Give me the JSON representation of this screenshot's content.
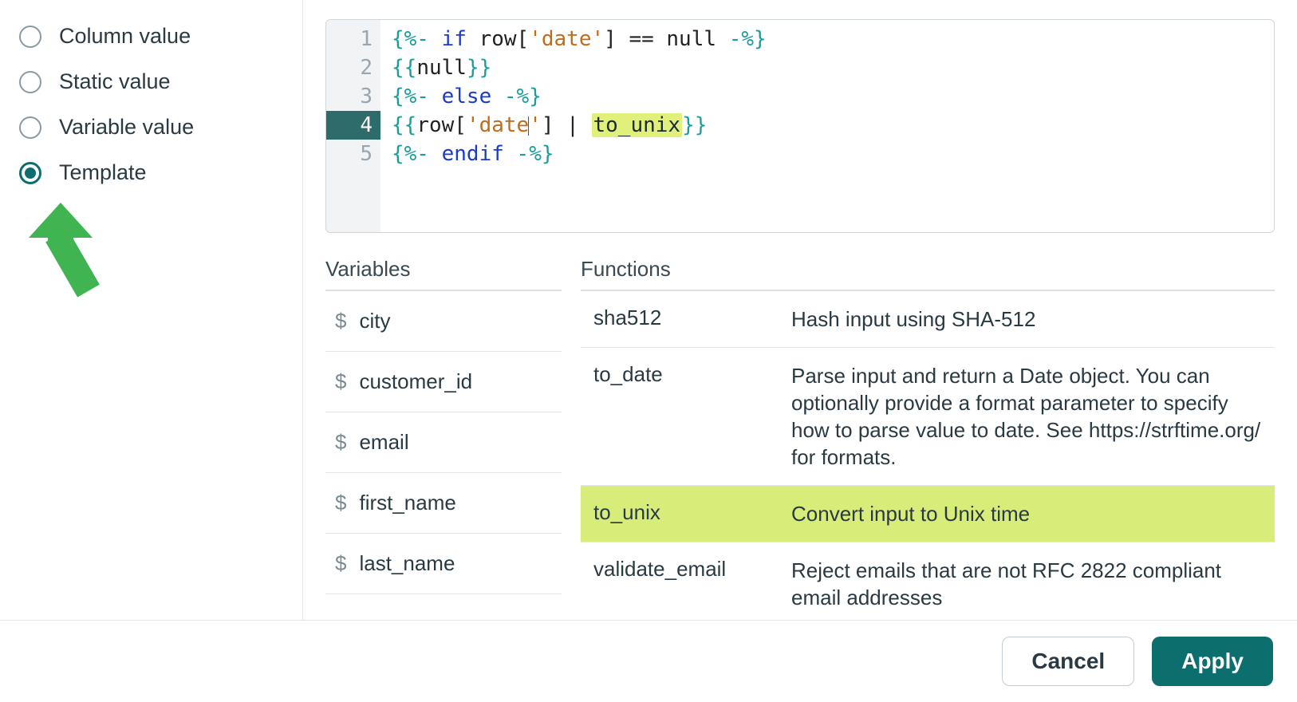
{
  "sidebar": {
    "options": [
      {
        "label": "Column value",
        "selected": false
      },
      {
        "label": "Static value",
        "selected": false
      },
      {
        "label": "Variable value",
        "selected": false
      },
      {
        "label": "Template",
        "selected": true
      }
    ]
  },
  "editor": {
    "active_line": 4,
    "lines": [
      {
        "n": 1,
        "tokens": [
          {
            "t": "{%- ",
            "c": "delim"
          },
          {
            "t": "if",
            "c": "kw"
          },
          {
            "t": " row[",
            "c": "text"
          },
          {
            "t": "'date'",
            "c": "str"
          },
          {
            "t": "] == null ",
            "c": "text"
          },
          {
            "t": "-%}",
            "c": "delim"
          }
        ]
      },
      {
        "n": 2,
        "tokens": [
          {
            "t": "{{",
            "c": "delim"
          },
          {
            "t": "null",
            "c": "text"
          },
          {
            "t": "}}",
            "c": "delim"
          }
        ]
      },
      {
        "n": 3,
        "tokens": [
          {
            "t": "{%- ",
            "c": "delim"
          },
          {
            "t": "else",
            "c": "kw"
          },
          {
            "t": " -%}",
            "c": "delim"
          }
        ]
      },
      {
        "n": 4,
        "tokens": [
          {
            "t": "{{",
            "c": "delim"
          },
          {
            "t": "row[",
            "c": "text"
          },
          {
            "t": "'date",
            "c": "str"
          },
          {
            "t": "|",
            "c": "cursor"
          },
          {
            "t": "'",
            "c": "str"
          },
          {
            "t": "] | ",
            "c": "text"
          },
          {
            "t": "to_unix",
            "c": "hilite"
          },
          {
            "t": "}}",
            "c": "delim"
          }
        ]
      },
      {
        "n": 5,
        "tokens": [
          {
            "t": "{%- ",
            "c": "delim"
          },
          {
            "t": "endif",
            "c": "kw"
          },
          {
            "t": " -%}",
            "c": "delim"
          }
        ]
      }
    ]
  },
  "variables": {
    "header": "Variables",
    "items": [
      {
        "name": "city"
      },
      {
        "name": "customer_id"
      },
      {
        "name": "email"
      },
      {
        "name": "first_name"
      },
      {
        "name": "last_name"
      }
    ]
  },
  "functions": {
    "header": "Functions",
    "items": [
      {
        "name": "sha512",
        "desc": "Hash input using SHA-512",
        "highlight": false
      },
      {
        "name": "to_date",
        "desc": "Parse input and return a Date object. You can optionally provide a format parameter to specify how to parse value to date. See https://strftime.org/ for formats.",
        "highlight": false
      },
      {
        "name": "to_unix",
        "desc": "Convert input to Unix time",
        "highlight": true
      },
      {
        "name": "validate_email",
        "desc": "Reject emails that are not RFC 2822 compliant email addresses",
        "highlight": false
      }
    ]
  },
  "footer": {
    "cancel": "Cancel",
    "apply": "Apply"
  },
  "annotation": {
    "arrow_color": "#3fb451",
    "highlight_color": "#d8ec7a"
  }
}
